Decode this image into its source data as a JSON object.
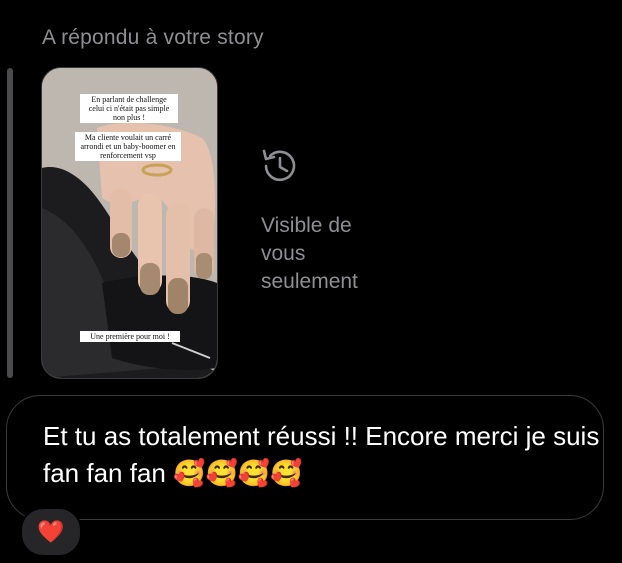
{
  "reply_header": "A répondu à votre story",
  "story": {
    "caption_1": "En parlant de challenge celui ci n'était pas simple non plus !",
    "caption_2": "Ma cliente voulait un carré arrondi et un baby-boomer en renforcement vsp",
    "caption_3": "Une première pour moi !"
  },
  "visibility": {
    "icon": "history-clock-icon",
    "label": "Visible de vous seulement"
  },
  "message": {
    "text": "Et tu as totalement réussi !! Encore merci je suis fan fan fan 🥰🥰🥰🥰"
  },
  "reaction": {
    "emoji": "❤️",
    "color": "#e0245e"
  }
}
